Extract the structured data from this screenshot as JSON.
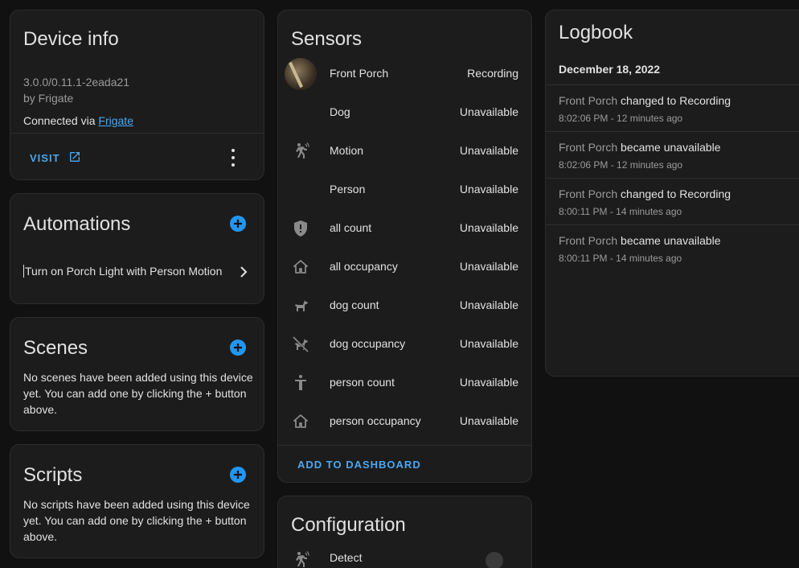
{
  "device_info": {
    "title": "Device info",
    "version": "3.0.0/0.11.1-2eada21",
    "manufacturer": "by Frigate",
    "connected_prefix": "Connected via ",
    "connected_link": "Frigate",
    "visit_label": "VISIT"
  },
  "automations": {
    "title": "Automations",
    "items": [
      {
        "label": "Turn on Porch Light with Person Motion"
      }
    ]
  },
  "scenes": {
    "title": "Scenes",
    "empty_text": "No scenes have been added using this device yet. You can add one by clicking the + button above."
  },
  "scripts": {
    "title": "Scripts",
    "empty_text": "No scripts have been added using this device yet. You can add one by clicking the + button above."
  },
  "sensors": {
    "title": "Sensors",
    "rows": [
      {
        "name": "Front Porch",
        "state": "Recording",
        "icon": "camera-thumbnail"
      },
      {
        "name": "Dog",
        "state": "Unavailable",
        "icon": "none"
      },
      {
        "name": "Motion",
        "state": "Unavailable",
        "icon": "motion-sensor-icon"
      },
      {
        "name": "Person",
        "state": "Unavailable",
        "icon": "none"
      },
      {
        "name": "all count",
        "state": "Unavailable",
        "icon": "shield-alert-icon"
      },
      {
        "name": "all occupancy",
        "state": "Unavailable",
        "icon": "home-outline-icon"
      },
      {
        "name": "dog count",
        "state": "Unavailable",
        "icon": "dog-icon"
      },
      {
        "name": "dog occupancy",
        "state": "Unavailable",
        "icon": "dog-off-icon"
      },
      {
        "name": "person count",
        "state": "Unavailable",
        "icon": "human-icon"
      },
      {
        "name": "person occupancy",
        "state": "Unavailable",
        "icon": "home-outline-icon"
      }
    ],
    "add_to_dashboard": "ADD TO DASHBOARD"
  },
  "configuration": {
    "title": "Configuration",
    "rows": [
      {
        "name": "Detect",
        "icon": "motion-sensor-icon"
      }
    ]
  },
  "logbook": {
    "title": "Logbook",
    "date": "December 18, 2022",
    "entries": [
      {
        "entity": "Front Porch",
        "message": " changed to Recording",
        "time": "8:02:06 PM - 12 minutes ago"
      },
      {
        "entity": "Front Porch",
        "message": " became unavailable",
        "time": "8:02:06 PM - 12 minutes ago"
      },
      {
        "entity": "Front Porch",
        "message": " changed to Recording",
        "time": "8:00:11 PM - 14 minutes ago"
      },
      {
        "entity": "Front Porch",
        "message": " became unavailable",
        "time": "8:00:11 PM - 14 minutes ago"
      }
    ]
  },
  "colors": {
    "background": "#111111",
    "card": "#1c1c1c",
    "accent": "#2196f3",
    "link": "#4aa8f0",
    "secondary_text": "#9b9b9b"
  }
}
